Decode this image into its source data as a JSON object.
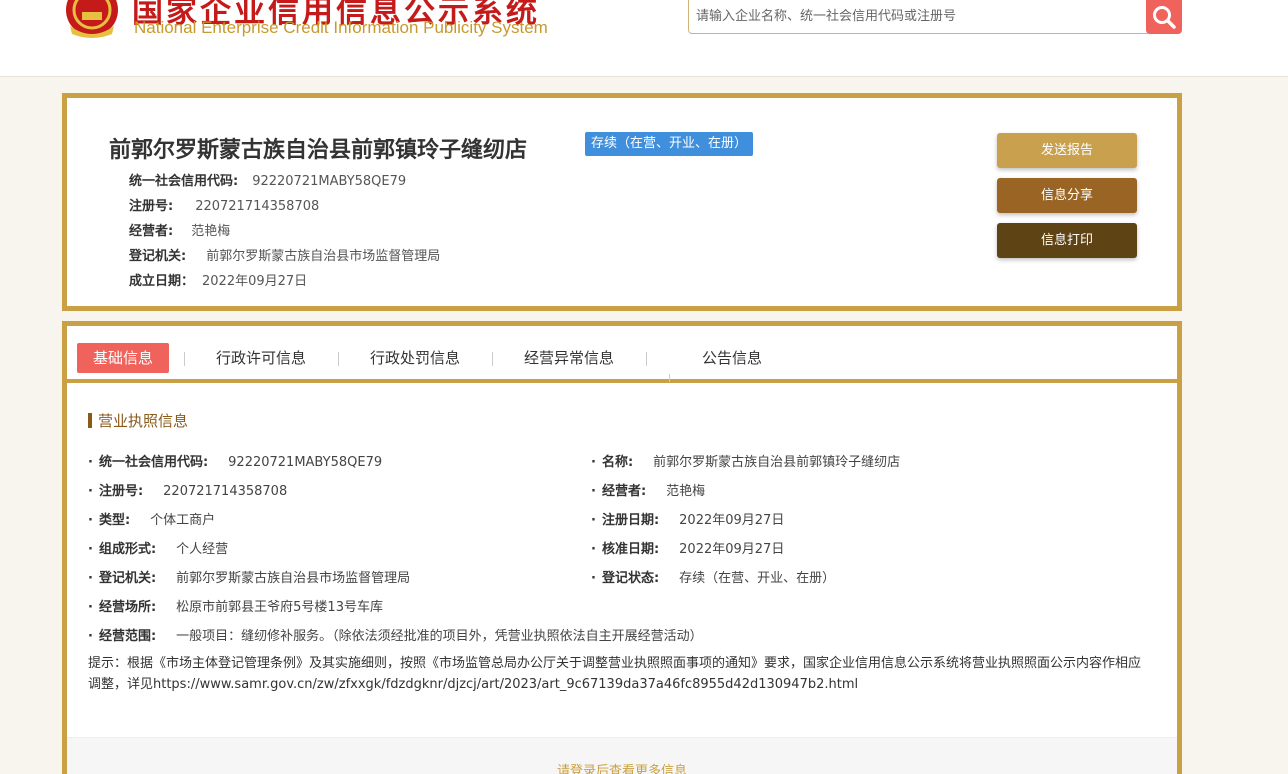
{
  "header": {
    "title_cn": "国家企业信用信息公示系统",
    "title_en": "National Enterprise Credit Information Publicity System",
    "search_placeholder": "请输入企业名称、统一社会信用代码或注册号"
  },
  "company": {
    "name": "前郭尔罗斯蒙古族自治县前郭镇玲子缝纫店",
    "status": "存续（在营、开业、在册）",
    "fields": [
      {
        "label": "统一社会信用代码:",
        "value": "92220721MABY58QE79"
      },
      {
        "label": "注册号:",
        "value": "220721714358708"
      },
      {
        "label": "经营者:",
        "value": "范艳梅"
      },
      {
        "label": "登记机关:",
        "value": "前郭尔罗斯蒙古族自治县市场监督管理局"
      },
      {
        "label": "成立日期：",
        "value": "2022年09月27日"
      }
    ]
  },
  "actions": {
    "send_report": "发送报告",
    "share": "信息分享",
    "print": "信息打印"
  },
  "colors": {
    "btn1": "#c9a14e",
    "btn2": "#9a6524",
    "btn3": "#5e4315",
    "border": "#c9a144",
    "accent_red": "#f0625c",
    "badge_blue": "#3f8fdd"
  },
  "tabs": [
    "基础信息",
    "行政许可信息",
    "行政处罚信息",
    "经营异常信息",
    "公告信息"
  ],
  "license": {
    "section_title": "营业执照信息",
    "left": [
      {
        "label": "统一社会信用代码:",
        "value": "92220721MABY58QE79"
      },
      {
        "label": "注册号:",
        "value": "220721714358708"
      },
      {
        "label": "类型:",
        "value": "个体工商户"
      },
      {
        "label": "组成形式:",
        "value": "个人经营"
      },
      {
        "label": "登记机关:",
        "value": "前郭尔罗斯蒙古族自治县市场监督管理局"
      },
      {
        "label": "经营场所:",
        "value": "松原市前郭县王爷府5号楼13号车库"
      },
      {
        "label": "经营范围:",
        "value": "一般项目：缝纫修补服务。（除依法须经批准的项目外，凭营业执照依法自主开展经营活动）"
      }
    ],
    "right": [
      {
        "label": "名称:",
        "value": "前郭尔罗斯蒙古族自治县前郭镇玲子缝纫店"
      },
      {
        "label": "经营者:",
        "value": "范艳梅"
      },
      {
        "label": "注册日期:",
        "value": "2022年09月27日"
      },
      {
        "label": "核准日期:",
        "value": "2022年09月27日"
      },
      {
        "label": "登记状态:",
        "value": "存续（在营、开业、在册）"
      }
    ],
    "notice": "提示：根据《市场主体登记管理条例》及其实施细则，按照《市场监管总局办公厅关于调整营业执照照面事项的通知》要求，国家企业信用信息公示系统将营业执照照面公示内容作相应调整，详见https://www.samr.gov.cn/zw/zfxxgk/fdzdgknr/djzcj/art/2023/art_9c67139da37a46fc8955d42d130947b2.html"
  },
  "login_prompt": "请登录后查看更多信息"
}
